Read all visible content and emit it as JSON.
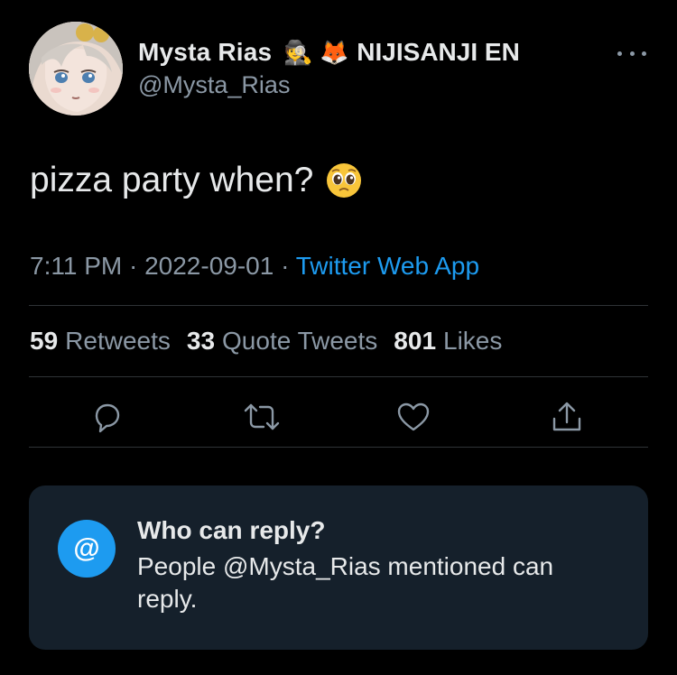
{
  "author": {
    "display_name": "Mysta Rias",
    "emoji_1": "🕵️",
    "emoji_2": "🦊",
    "affiliation": "NIJISANJI EN",
    "handle": "@Mysta_Rias"
  },
  "tweet": {
    "text": "pizza party when?",
    "emoji": "🥺"
  },
  "meta": {
    "time": "7:11 PM",
    "separator": " · ",
    "date": "2022-09-01",
    "separator2": " · ",
    "source": "Twitter Web App"
  },
  "stats": {
    "retweets_count": "59",
    "retweets_label": "Retweets",
    "quotes_count": "33",
    "quotes_label": "Quote Tweets",
    "likes_count": "801",
    "likes_label": "Likes"
  },
  "actions": {
    "reply_icon": "reply-bubble-icon",
    "retweet_icon": "retweet-icon",
    "like_icon": "heart-icon",
    "share_icon": "share-icon"
  },
  "reply_settings": {
    "icon_symbol": "@",
    "title": "Who can reply?",
    "body": "People @Mysta_Rias mentioned can reply."
  },
  "colors": {
    "background": "#000000",
    "text": "#e7e9ea",
    "secondary": "#8b98a5",
    "accent": "#1d9bf0",
    "card": "#15202b"
  }
}
